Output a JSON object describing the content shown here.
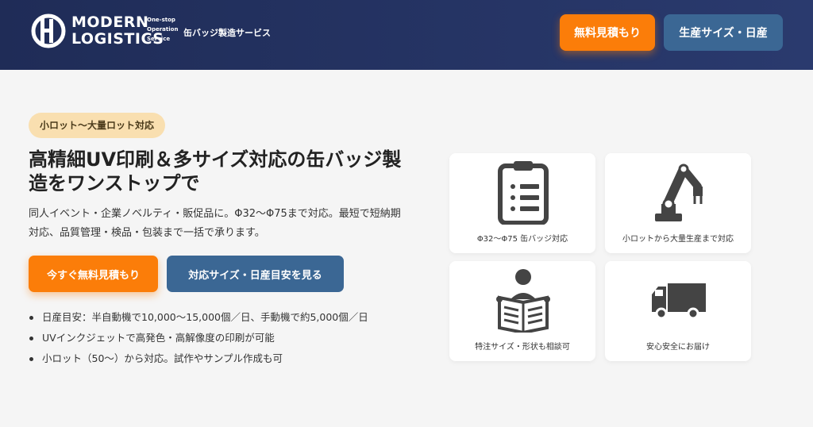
{
  "header": {
    "logo_line1": "MODERN",
    "logo_line2": "LOGISTICS",
    "logo_tagline": [
      "One-stop",
      "Operation",
      "Service"
    ],
    "service_name": "缶バッジ製造サービス",
    "quote_button": "無料見積もり",
    "size_button": "生産サイズ・日産"
  },
  "hero": {
    "badge": "小ロット〜大量ロット対応",
    "title": "高精細UV印刷＆多サイズ対応の缶バッジ製造をワンストップで",
    "description": "同人イベント・企業ノベルティ・販促品に。Φ32〜Φ75まで対応。最短で短納期対応、品質管理・検品・包装まで一括で承ります。",
    "cta_quote": "今すぐ無料見積もり",
    "cta_size": "対応サイズ・日産目安を見る",
    "features": [
      "日産目安：半自動機で10,000〜15,000個／日、手動機で約5,000個／日",
      "UVインクジェットで高発色・高解像度の印刷が可能",
      "小ロット（50〜）から対応。試作やサンプル作成も可"
    ]
  },
  "cards": [
    {
      "icon": "clipboard-icon",
      "label": "Φ32〜Φ75 缶バッジ対応"
    },
    {
      "icon": "robot-arm-icon",
      "label": "小ロットから大量生産まで対応"
    },
    {
      "icon": "newspaper-reader-icon",
      "label": "特注サイズ・形状も相談可"
    },
    {
      "icon": "delivery-truck-icon",
      "label": "安心安全にお届け"
    }
  ],
  "colors": {
    "header_bg": "#1f2c57",
    "accent_orange": "#fb7d09",
    "accent_blue": "#3b6794",
    "badge_bg": "#f9dfb0",
    "icon_gray": "#444444"
  }
}
